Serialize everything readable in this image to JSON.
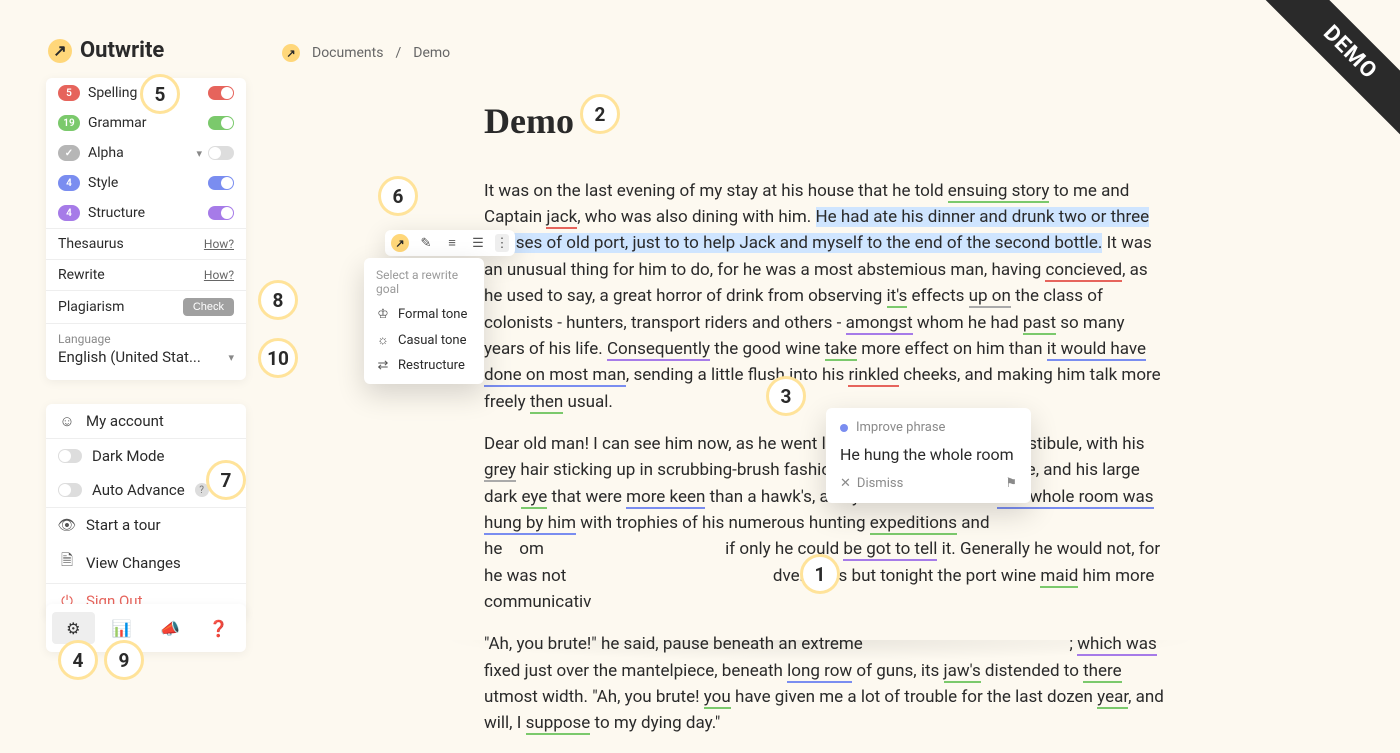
{
  "app": {
    "name": "Outwrite"
  },
  "breadcrumb": {
    "root": "Documents",
    "current": "Demo"
  },
  "demo_ribbon": "DEMO",
  "checks": {
    "spelling": {
      "label": "Spelling",
      "count": "5",
      "on": true
    },
    "grammar": {
      "label": "Grammar",
      "count": "19",
      "on": true
    },
    "alpha": {
      "label": "Alpha",
      "count": "✓",
      "on": false
    },
    "style": {
      "label": "Style",
      "count": "4",
      "on": true
    },
    "structure": {
      "label": "Structure",
      "count": "4",
      "on": true
    }
  },
  "tools": {
    "thesaurus": {
      "label": "Thesaurus",
      "hint": "How?"
    },
    "rewrite": {
      "label": "Rewrite",
      "hint": "How?"
    },
    "plagiarism": {
      "label": "Plagiarism",
      "button": "Check"
    }
  },
  "language": {
    "label": "Language",
    "value": "English (United Stat..."
  },
  "account": {
    "my_account": "My account",
    "dark_mode": "Dark Mode",
    "auto_advance": "Auto Advance",
    "start_tour": "Start a tour",
    "view_changes": "View Changes",
    "sign_out": "Sign Out"
  },
  "rewrite_menu": {
    "header": "Select a rewrite goal",
    "items": {
      "formal": "Formal tone",
      "casual": "Casual tone",
      "restructure": "Restructure"
    }
  },
  "suggestion": {
    "category": "Improve phrase",
    "text": "He hung the whole room",
    "dismiss": "Dismiss"
  },
  "document": {
    "title": "Demo"
  },
  "callouts": {
    "c1": "1",
    "c2": "2",
    "c3": "3",
    "c4": "4",
    "c5": "5",
    "c6": "6",
    "c7": "7",
    "c8": "8",
    "c9": "9",
    "c10": "10"
  }
}
